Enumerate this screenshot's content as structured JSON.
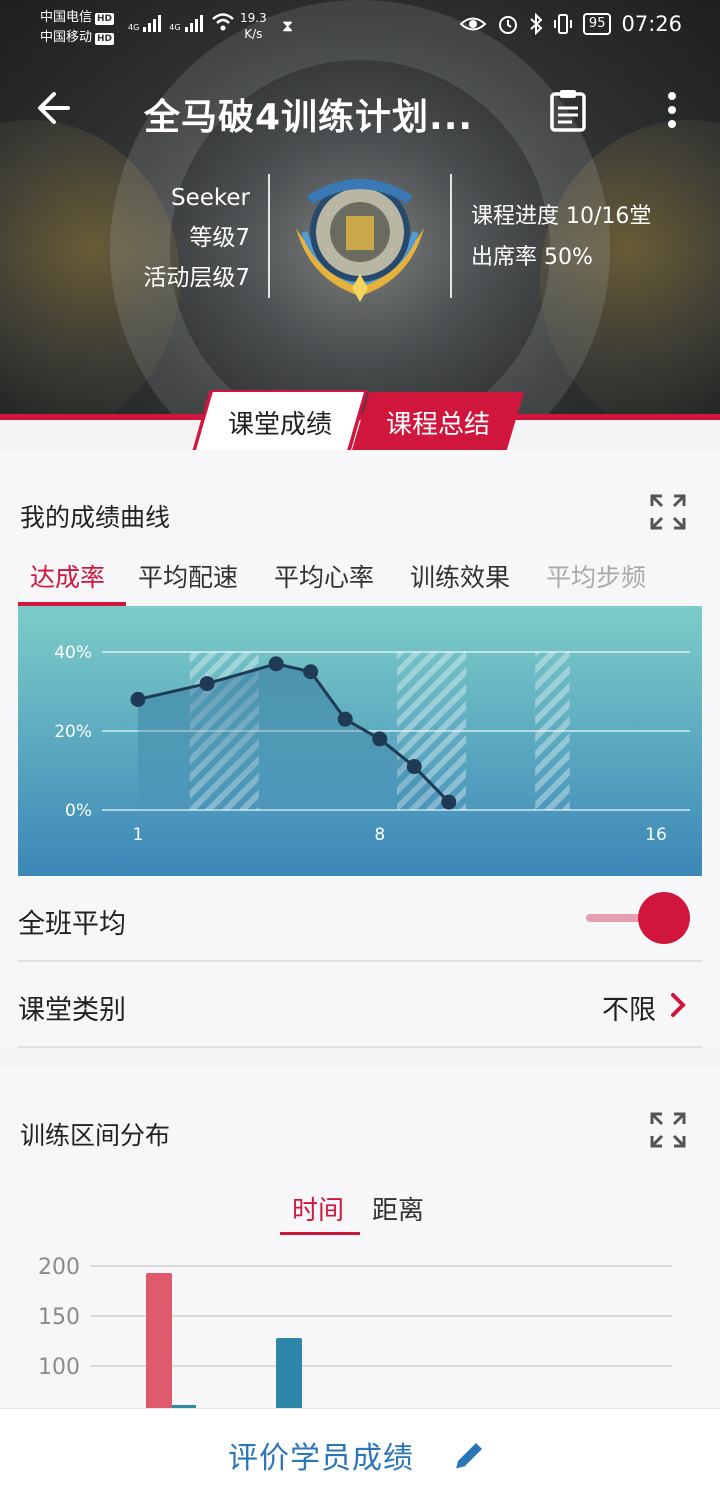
{
  "status_bar": {
    "carrier1": "中国电信",
    "carrier2": "中国移动",
    "hd": "HD",
    "net_type": "4G",
    "speed_value": "19.3",
    "speed_unit": "K/s",
    "battery": "95",
    "time": "07:26"
  },
  "header": {
    "title": "全马破4训练计划..."
  },
  "profile": {
    "name": "Seeker",
    "level": "等级7",
    "activity_level": "活动层级7",
    "progress": "课程进度 10/16堂",
    "attendance": "出席率 50%"
  },
  "tabs": {
    "tab1": "课堂成绩",
    "tab2": "课程总结"
  },
  "score_curve": {
    "title": "我的成绩曲线",
    "metrics": [
      "达成率",
      "平均配速",
      "平均心率",
      "训练效果",
      "平均步频"
    ],
    "active_metric": "达成率"
  },
  "chart_data": [
    {
      "type": "line",
      "title": "",
      "xlabel": "",
      "ylabel": "",
      "x_ticks": [
        "1",
        "8",
        "16"
      ],
      "y_ticks": [
        "0%",
        "20%",
        "40%"
      ],
      "xlim": [
        1,
        16
      ],
      "ylim": [
        0,
        40
      ],
      "series": [
        {
          "x": [
            1,
            3,
            5,
            6,
            7,
            8,
            9,
            10
          ],
          "values": [
            28,
            32,
            37,
            35,
            23,
            18,
            11,
            2
          ]
        }
      ],
      "hatched_columns": [
        3,
        4,
        9,
        10,
        13
      ],
      "grid": true
    },
    {
      "type": "bar",
      "title": "",
      "y_ticks": [
        "200",
        "150",
        "100"
      ],
      "ylim_visible": [
        100,
        200
      ],
      "series": [
        {
          "color": "#e05a6e",
          "values": [
            193
          ]
        },
        {
          "color": "#2e87a8",
          "values": [
            128
          ]
        }
      ]
    }
  ],
  "class_average": {
    "label": "全班平均",
    "on": true
  },
  "class_type": {
    "label": "课堂类别",
    "value": "不限"
  },
  "zones": {
    "title": "训练区间分布",
    "toggle_time": "时间",
    "toggle_distance": "距离"
  },
  "footer": {
    "label": "评价学员成绩"
  },
  "colors": {
    "accent": "#d0163c",
    "link": "#2a76b8",
    "chart_top": "#7ccdc8",
    "chart_bottom": "#3c86b8"
  }
}
